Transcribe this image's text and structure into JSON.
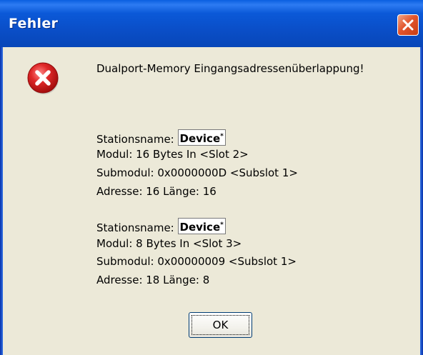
{
  "dialog": {
    "title": "Fehler",
    "message": "Dualport-Memory Eingangsadressenüberlappung!",
    "ok_label": "OK",
    "entries": [
      {
        "station_label": "Stationsname: ",
        "device_name": "Device",
        "device_marker": "*",
        "modul": "Modul: 16 Bytes In <Slot 2>",
        "submodul": "Submodul: 0x0000000D <Subslot 1>",
        "adresse": "Adresse: 16 Länge: 16"
      },
      {
        "station_label": "Stationsname: ",
        "device_name": "Device",
        "device_marker": "*",
        "modul": "Modul: 8 Bytes In <Slot 3>",
        "submodul": "Submodul: 0x00000009 <Subslot 1>",
        "adresse": "Adresse: 18 Länge: 8"
      }
    ]
  },
  "icons": {
    "error": "error-icon",
    "close": "close-icon"
  },
  "colors": {
    "titlebar": "#0a4fc9",
    "dialog_bg": "#ece9d8",
    "close_button": "#e2552d",
    "error_red": "#d81e1e"
  }
}
